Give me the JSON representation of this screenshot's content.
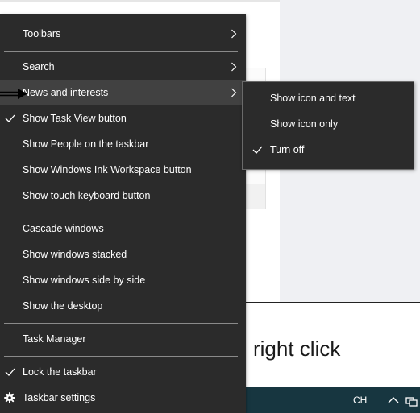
{
  "background": {
    "instruction_text": "right click",
    "tray": {
      "language": "CH"
    }
  },
  "context_menu": {
    "items": [
      {
        "label": "Toolbars",
        "submenu": true
      },
      {
        "label": "Search",
        "submenu": true
      },
      {
        "label": "News and interests",
        "submenu": true,
        "highlighted": true
      },
      {
        "label": "Show Task View button",
        "checked": true
      },
      {
        "label": "Show People on the taskbar"
      },
      {
        "label": "Show Windows Ink Workspace button"
      },
      {
        "label": "Show touch keyboard button"
      },
      {
        "label": "Cascade windows"
      },
      {
        "label": "Show windows stacked"
      },
      {
        "label": "Show windows side by side"
      },
      {
        "label": "Show the desktop"
      },
      {
        "label": "Task Manager"
      },
      {
        "label": "Lock the taskbar",
        "checked": true
      },
      {
        "label": "Taskbar settings",
        "icon": "gear-icon"
      }
    ]
  },
  "news_submenu": {
    "items": [
      {
        "label": "Show icon and text"
      },
      {
        "label": "Show icon only"
      },
      {
        "label": "Turn off",
        "checked": true
      }
    ]
  },
  "colors": {
    "menu_bg": "#2b2b2b",
    "menu_highlight": "#414141",
    "menu_text": "#ffffff",
    "separator": "#8a8a8a",
    "taskbar": "#173640"
  }
}
